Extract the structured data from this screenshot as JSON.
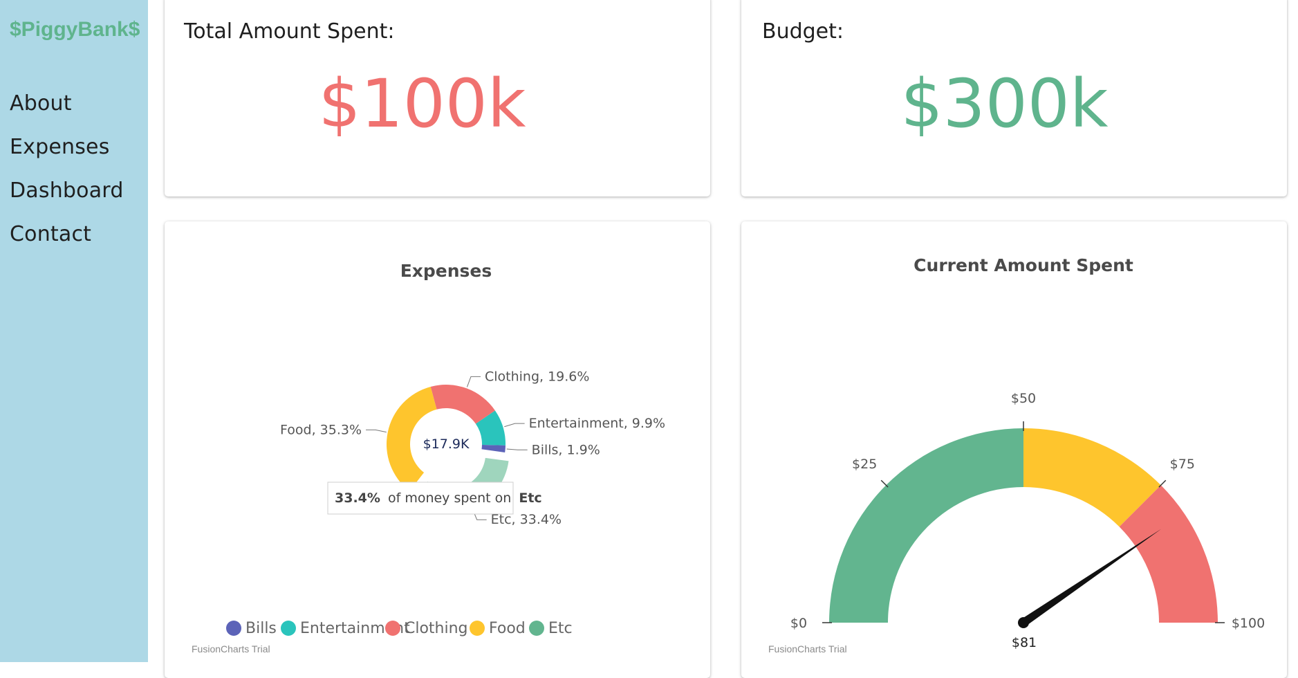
{
  "app": {
    "brand": "$PiggyBank$"
  },
  "nav": [
    {
      "label": "About"
    },
    {
      "label": "Expenses"
    },
    {
      "label": "Dashboard"
    },
    {
      "label": "Contact"
    }
  ],
  "stats": {
    "total_spent_label": "Total Amount Spent:",
    "total_spent_value": "$100k",
    "budget_label": "Budget:",
    "budget_value": "$300k"
  },
  "colors": {
    "bills": "#5c63b8",
    "entertainment": "#2ac4bc",
    "clothing": "#f07270",
    "food": "#fec52d",
    "etc": "#62b58f",
    "etc_faded": "#9fd5bd"
  },
  "chart_data": [
    {
      "type": "pie",
      "variant": "doughnut",
      "title": "Expenses",
      "center_label": "$17.9K",
      "slices": [
        {
          "name": "Bills",
          "percent": 1.9,
          "label": "Bills, 1.9%"
        },
        {
          "name": "Entertainment",
          "percent": 9.9,
          "label": "Entertainment, 9.9%"
        },
        {
          "name": "Clothing",
          "percent": 19.6,
          "label": "Clothing, 19.6%"
        },
        {
          "name": "Food",
          "percent": 35.3,
          "label": "Food, 35.3%"
        },
        {
          "name": "Etc",
          "percent": 33.4,
          "label": "Etc, 33.4%"
        }
      ],
      "legend": [
        "Bills",
        "Entertainment",
        "Clothing",
        "Food",
        "Etc"
      ],
      "legend_position": "bottom",
      "tooltip": {
        "percent": "33.4%",
        "mid": "of money spent on",
        "category": "Etc"
      },
      "watermark": "FusionCharts Trial"
    },
    {
      "type": "gauge",
      "title": "Current Amount Spent",
      "min": 0,
      "max": 100,
      "value": 81,
      "value_label": "$81",
      "ticks": [
        {
          "value": 0,
          "label": "$0"
        },
        {
          "value": 25,
          "label": "$25"
        },
        {
          "value": 50,
          "label": "$50"
        },
        {
          "value": 75,
          "label": "$75"
        },
        {
          "value": 100,
          "label": "$100"
        }
      ],
      "color_ranges": [
        {
          "from": 0,
          "to": 50,
          "color": "#62b58f"
        },
        {
          "from": 50,
          "to": 75,
          "color": "#fec52d"
        },
        {
          "from": 75,
          "to": 100,
          "color": "#f07270"
        }
      ],
      "watermark": "FusionCharts Trial"
    }
  ]
}
